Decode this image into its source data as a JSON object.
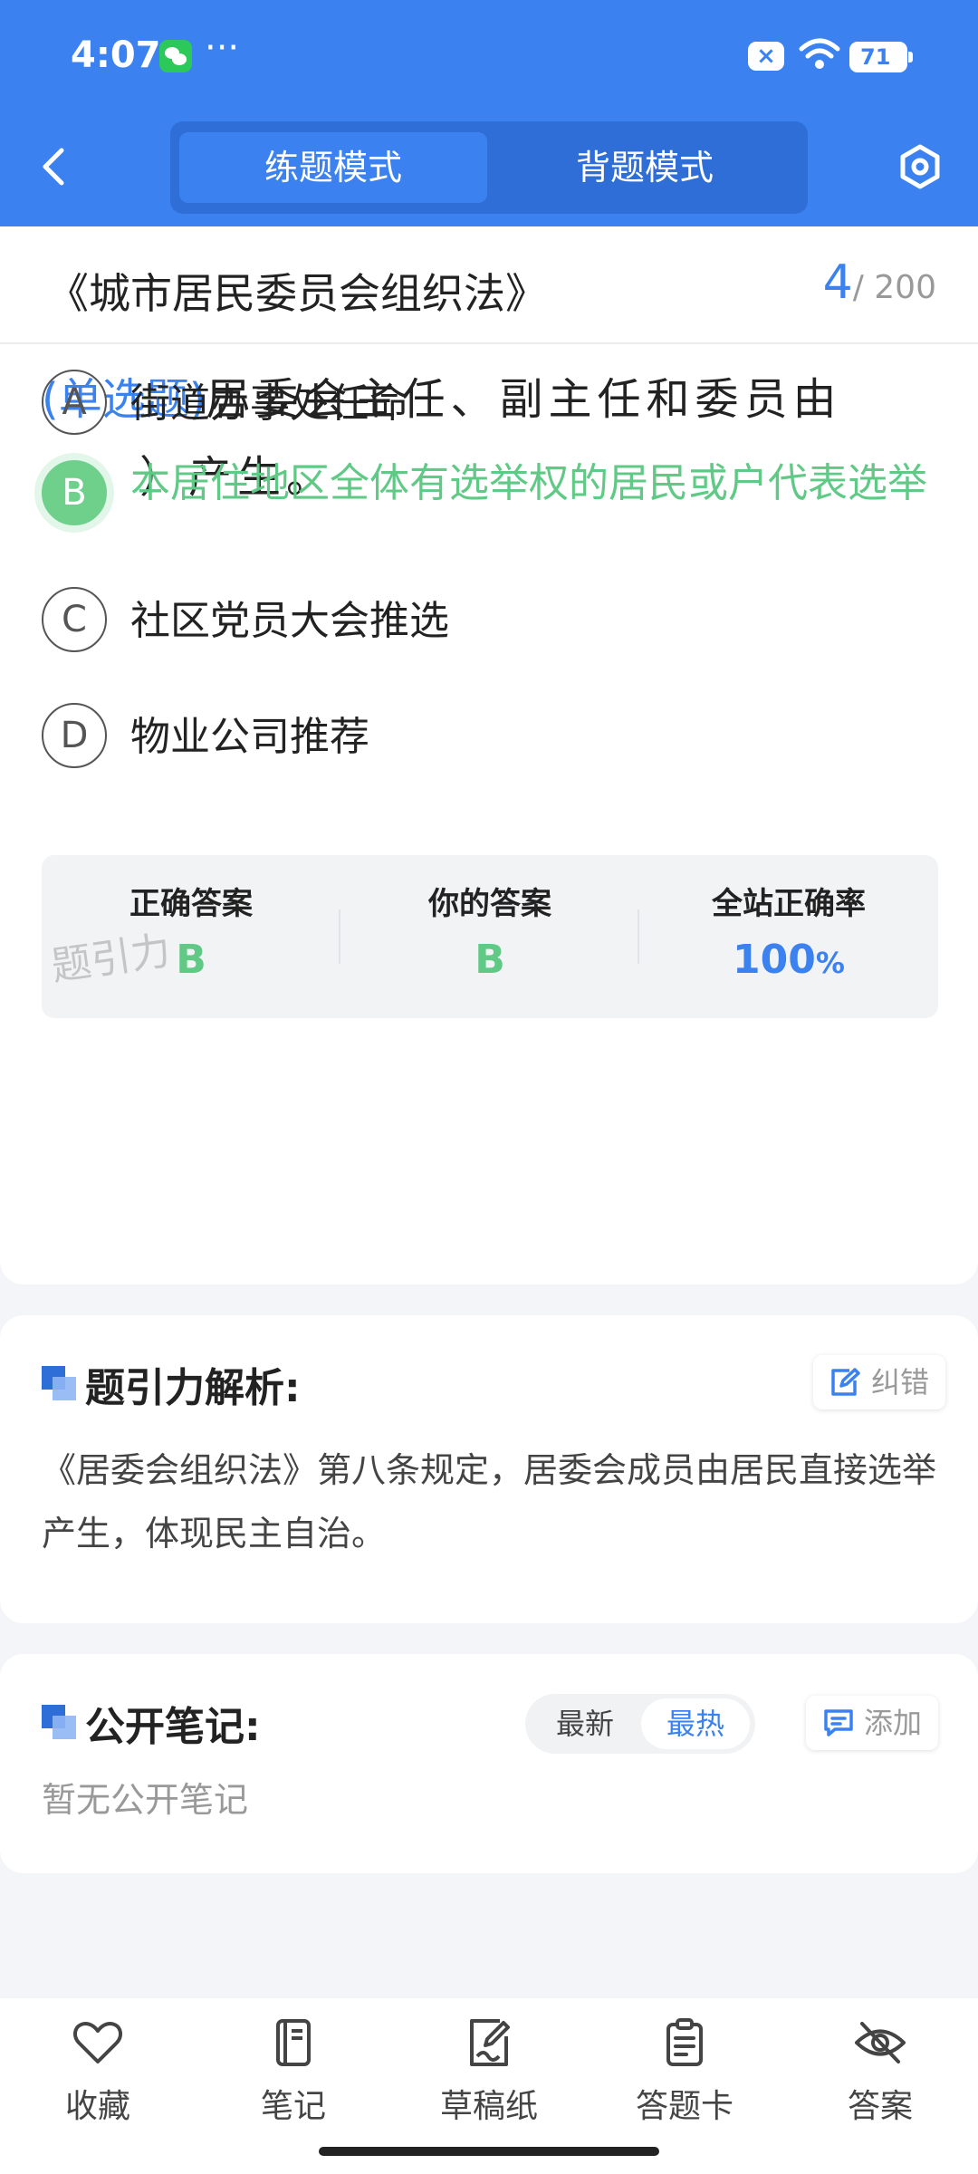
{
  "status_bar": {
    "time": "4:07",
    "more": "···",
    "battery": "71"
  },
  "header": {
    "mode_practice": "练题模式",
    "mode_memorize": "背题模式"
  },
  "question_header": {
    "book_title": "《城市居民委员会组织法》",
    "current": "4",
    "total": "/ 200"
  },
  "question": {
    "type": "(单选题)",
    "text": "居委会主任、副主任和委员由（　）产生。",
    "options": [
      {
        "letter": "A",
        "text": "街道办事处任命"
      },
      {
        "letter": "B",
        "text": "本居住地区全体有选举权的居民或户代表选举"
      },
      {
        "letter": "C",
        "text": "社区党员大会推选"
      },
      {
        "letter": "D",
        "text": "物业公司推荐"
      }
    ]
  },
  "answers": {
    "correct_label": "正确答案",
    "correct_value": "B",
    "yours_label": "你的答案",
    "yours_value": "B",
    "rate_label": "全站正确率",
    "rate_value": "100",
    "rate_unit": "%",
    "watermark": "题引力"
  },
  "analysis": {
    "title": "题引力解析:",
    "report_label": "纠错",
    "text": "《居委会组织法》第八条规定，居委会成员由居民直接选举产生，体现民主自治。"
  },
  "notes": {
    "title": "公开笔记:",
    "sort_newest": "最新",
    "sort_hottest": "最热",
    "add_label": "添加",
    "empty_text": "暂无公开笔记"
  },
  "bottom_tabs": [
    {
      "label": "收藏",
      "icon": "heart-icon"
    },
    {
      "label": "笔记",
      "icon": "notebook-icon"
    },
    {
      "label": "草稿纸",
      "icon": "draft-icon"
    },
    {
      "label": "答题卡",
      "icon": "answer-sheet-icon"
    },
    {
      "label": "答案",
      "icon": "eye-off-icon"
    }
  ],
  "colors": {
    "primary": "#3b82f0",
    "correct": "#5fc985"
  }
}
